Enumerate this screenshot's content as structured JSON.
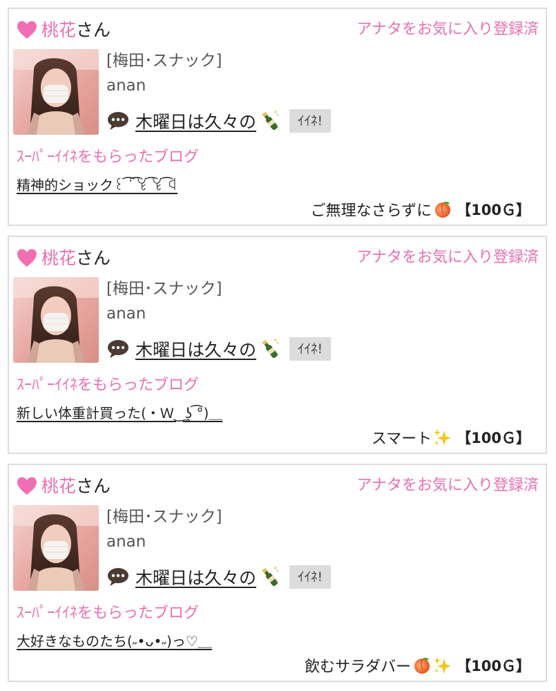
{
  "colors": {
    "accent_pink": "#ea6fb0",
    "border": "#dcdcdc",
    "button_bg": "#dcdcdc"
  },
  "cards": [
    {
      "sender_name": "桃花",
      "honorific": "さん",
      "favorite_status": "アナタをお気に入り登録済",
      "location": "[梅田･スナック]",
      "cast_name": "anan",
      "latest_blog_title": "木曜日は久々の",
      "latest_blog_emoji": "champagne-bottle-icon",
      "iine_label": "ｲｲﾈ!",
      "section_heading": "ｽｰﾊﾟｰｲｲﾈをもらったブログ",
      "blog_title": "精神的ショック꒰ ͡ᐝ ͡ꒀ ͡ꒀ ͡ꒉ",
      "comment": "ご無理なさらずに",
      "comment_icons": [
        "peach-icon"
      ],
      "points": "【100Ｇ】"
    },
    {
      "sender_name": "桃花",
      "honorific": "さん",
      "favorite_status": "アナタをお気に入り登録済",
      "location": "[梅田･スナック]",
      "cast_name": "anan",
      "latest_blog_title": "木曜日は久々の",
      "latest_blog_emoji": "champagne-bottle-icon",
      "iine_label": "ｲｲﾈ!",
      "section_heading": "ｽｰﾊﾟｰｲｲﾈをもらったブログ",
      "blog_title": "新しい体重計買った(・Ｗ‿ʖ̯ ͡°)＿",
      "comment": "スマート",
      "comment_icons": [
        "sparkles-icon"
      ],
      "points": "【100Ｇ】"
    },
    {
      "sender_name": "桃花",
      "honorific": "さん",
      "favorite_status": "アナタをお気に入り登録済",
      "location": "[梅田･スナック]",
      "cast_name": "anan",
      "latest_blog_title": "木曜日は久々の",
      "latest_blog_emoji": "champagne-bottle-icon",
      "iine_label": "ｲｲﾈ!",
      "section_heading": "ｽｰﾊﾟｰｲｲﾈをもらったブログ",
      "blog_title": "大好きなものたち(˶•ᴗ•˶)っ♡＿",
      "comment": "飲むサラダバー",
      "comment_icons": [
        "peach-icon",
        "sparkles-icon"
      ],
      "points": "【100Ｇ】"
    }
  ]
}
